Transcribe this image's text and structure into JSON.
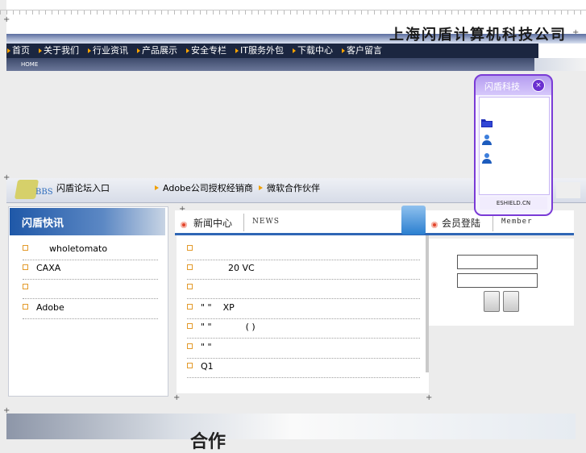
{
  "header": {
    "company_name": "上海闪盾计算机科技公司",
    "nav": [
      "首页",
      "关于我们",
      "行业资讯",
      "产品展示",
      "安全专栏",
      "IT服务外包",
      "下载中心",
      "客户留言"
    ],
    "home_label": "HOME"
  },
  "band2": {
    "bbs_logo_text": "BBS",
    "forum_link": "闪盾论坛入口",
    "adobe_link": "Adobe公司授权经销商",
    "ms_link": "微软合作伙伴"
  },
  "left_panel": {
    "title": "闪盾快讯",
    "items": [
      "wholetomato",
      "CAXA",
      "",
      "Adobe"
    ]
  },
  "news_panel": {
    "title": "新闻中心",
    "title_en": "NEWS",
    "items": [
      "",
      "20 VC",
      "",
      "\" \"    XP",
      "\" \"            ( )",
      "\" \"",
      "Q1"
    ]
  },
  "member_panel": {
    "title": "会员登陆",
    "title_en": "Member"
  },
  "widget": {
    "title": "闪盾科技",
    "close_glyph": "×",
    "footer": "ESHIELD.CN"
  },
  "bottom": {
    "banner_text": "合作"
  },
  "colors": {
    "nav_bg": "#1b2640",
    "accent_blue": "#2f66b5",
    "widget_purple": "#7a3bd6",
    "bullet_orange": "#e39a2a"
  }
}
